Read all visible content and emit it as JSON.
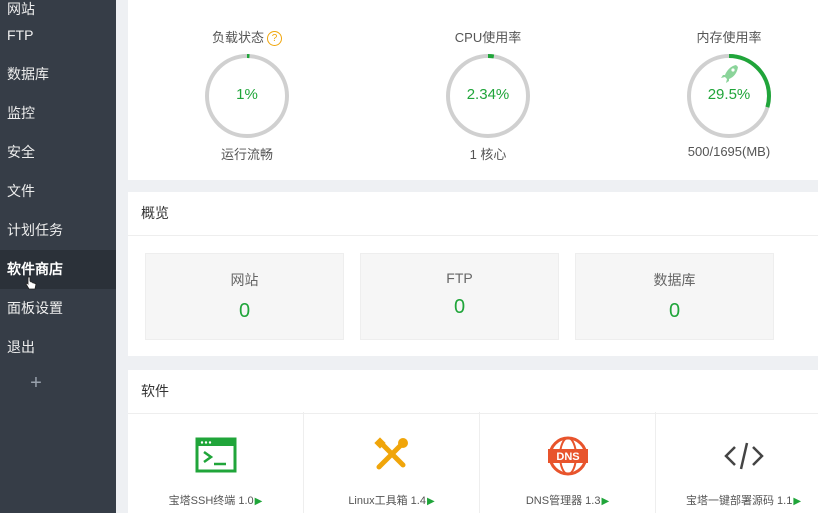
{
  "sidebar": {
    "partial_item": "网站",
    "items": [
      {
        "label": "FTP"
      },
      {
        "label": "数据库"
      },
      {
        "label": "监控"
      },
      {
        "label": "安全"
      },
      {
        "label": "文件"
      },
      {
        "label": "计划任务"
      },
      {
        "label": "软件商店"
      },
      {
        "label": "面板设置"
      },
      {
        "label": "退出"
      }
    ],
    "active_item": "软件商店",
    "add_label": "+"
  },
  "status": {
    "load": {
      "title": "负载状态",
      "value": "1%",
      "sub": "运行流畅",
      "percent": 1
    },
    "cpu": {
      "title": "CPU使用率",
      "value": "2.34%",
      "sub": "1 核心",
      "percent": 2.34
    },
    "memory": {
      "title": "内存使用率",
      "value": "29.5%",
      "sub": "500/1695(MB)",
      "percent": 29.5
    }
  },
  "overview": {
    "title": "概览",
    "stats": [
      {
        "label": "网站",
        "value": "0"
      },
      {
        "label": "FTP",
        "value": "0"
      },
      {
        "label": "数据库",
        "value": "0"
      }
    ]
  },
  "software": {
    "title": "软件",
    "items": [
      {
        "name": "宝塔SSH终端 1.0",
        "icon": "terminal-icon"
      },
      {
        "name": "Linux工具箱 1.4",
        "icon": "tools-icon"
      },
      {
        "name": "DNS管理器 1.3",
        "icon": "dns-icon"
      },
      {
        "name": "宝塔一键部署源码 1.1",
        "icon": "code-icon"
      }
    ]
  },
  "colors": {
    "accent": "#20a53a",
    "sidebar": "#363d47",
    "gauge_track": "#d0d0d0",
    "warn": "#f0a50a",
    "dns": "#e8542c"
  }
}
